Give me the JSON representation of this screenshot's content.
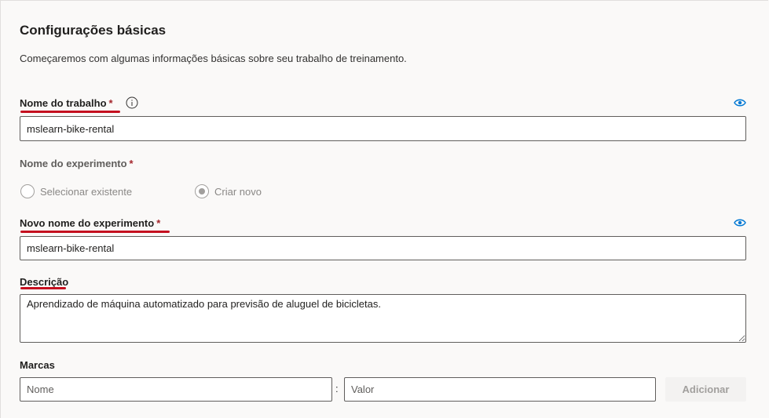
{
  "section": {
    "title": "Configurações básicas",
    "description": "Começaremos com algumas informações básicas sobre seu trabalho de treinamento."
  },
  "job_name": {
    "label": "Nome do trabalho",
    "required_mark": "*",
    "value": "mslearn-bike-rental"
  },
  "experiment": {
    "label": "Nome do experimento",
    "required_mark": "*",
    "options": [
      {
        "label": "Selecionar existente",
        "selected": false
      },
      {
        "label": "Criar novo",
        "selected": true
      }
    ]
  },
  "new_experiment_name": {
    "label": "Novo nome do experimento",
    "required_mark": "*",
    "value": "mslearn-bike-rental"
  },
  "description": {
    "label": "Descrição",
    "value": "Aprendizado de máquina automatizado para previsão de aluguel de bicicletas."
  },
  "tags": {
    "label": "Marcas",
    "name_placeholder": "Nome",
    "separator": ":",
    "value_placeholder": "Valor",
    "add_button_label": "Adicionar"
  },
  "colors": {
    "underline": "#c50f1f",
    "required": "#a4262c",
    "eye_icon": "#0078d4"
  }
}
